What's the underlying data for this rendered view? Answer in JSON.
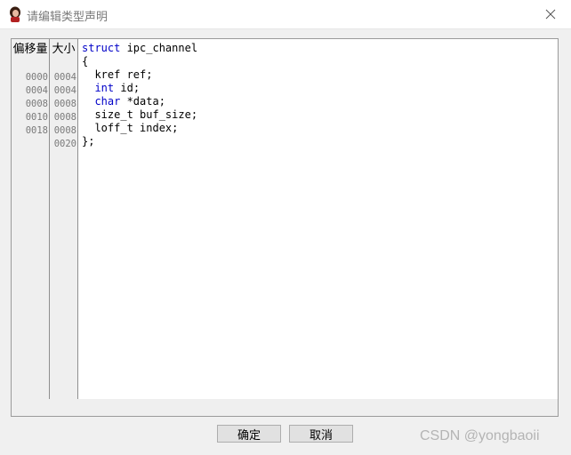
{
  "window": {
    "title": "请编辑类型声明",
    "icon": "avatar-icon",
    "close_icon": "close-icon"
  },
  "columns": {
    "offset_header": "偏移量",
    "size_header": "大小"
  },
  "offsets": [
    "0000",
    "0004",
    "0008",
    "0010",
    "0018"
  ],
  "sizes": [
    "0004",
    "0004",
    "0008",
    "0008",
    "0008",
    "0020"
  ],
  "code": {
    "line1_kw": "struct",
    "line1_rest": " ipc_channel",
    "line2": "{",
    "line3": "  kref ref;",
    "line4_indent": "  ",
    "line4_kw": "int",
    "line4_rest": " id;",
    "line5_indent": "  ",
    "line5_kw": "char",
    "line5_rest": " *data;",
    "line6": "  size_t buf_size;",
    "line7": "  loff_t index;",
    "line8": "};"
  },
  "buttons": {
    "ok": "确定",
    "cancel": "取消"
  },
  "watermark": "CSDN @yongbaoii",
  "colors": {
    "keyword": "#0000c8",
    "gutter_text": "#7a7a7a"
  }
}
